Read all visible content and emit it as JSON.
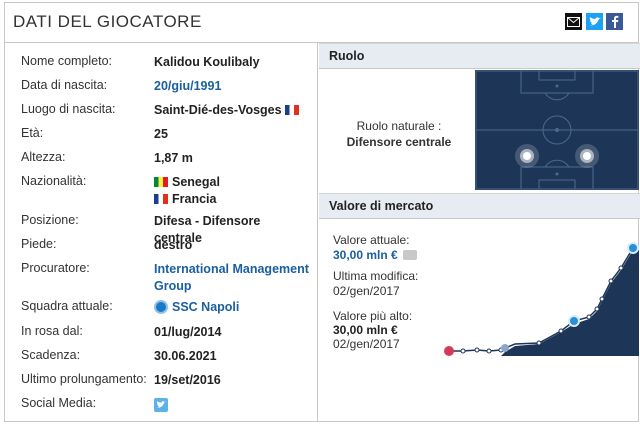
{
  "header": {
    "title": "DATI DEL GIOCATORE",
    "social_icons": [
      "mail-icon",
      "twitter-icon",
      "facebook-icon"
    ]
  },
  "player": {
    "rows": [
      {
        "label": "Nome completo:",
        "value": "Kalidou Koulibaly"
      },
      {
        "label": "Data di nascita:",
        "value": "20/giu/1991"
      },
      {
        "label": "Luogo di nascita:",
        "value": "Saint-Dié-des-Vosges"
      },
      {
        "label": "Età:",
        "value": "25"
      },
      {
        "label": "Altezza:",
        "value": "1,87 m"
      },
      {
        "label": "Nazionalità:",
        "value": "Senegal",
        "value2": "Francia"
      },
      {
        "label": "Posizione:",
        "value": "Difesa - Difensore centrale"
      },
      {
        "label": "Piede:",
        "value": "destro"
      },
      {
        "label": "Procuratore:",
        "value": "International Management",
        "value2": "Group"
      },
      {
        "label": "Squadra attuale:",
        "value": "SSC Napoli"
      },
      {
        "label": "In rosa dal:",
        "value": "01/lug/2014"
      },
      {
        "label": "Scadenza:",
        "value": "30.06.2021"
      },
      {
        "label": "Ultimo prolungamento:",
        "value": "19/set/2016"
      },
      {
        "label": "Social Media:",
        "value": ""
      }
    ]
  },
  "ruolo": {
    "heading": "Ruolo",
    "natural_label": "Ruolo naturale :",
    "natural_value": "Difensore centrale"
  },
  "market": {
    "heading": "Valore di mercato",
    "current_label": "Valore attuale:",
    "current_value": "30,00 mln €",
    "last_mod_label": "Ultima modifica:",
    "last_mod_value": "02/gen/2017",
    "highest_label": "Valore più alto:",
    "highest_value": "30,00 mln €",
    "highest_date": "02/gen/2017"
  },
  "colors": {
    "link": "#1a5fa0",
    "pitch": "#1d3557",
    "chart_fill": "#1d3557",
    "section_header": "#e6ecf2"
  }
}
